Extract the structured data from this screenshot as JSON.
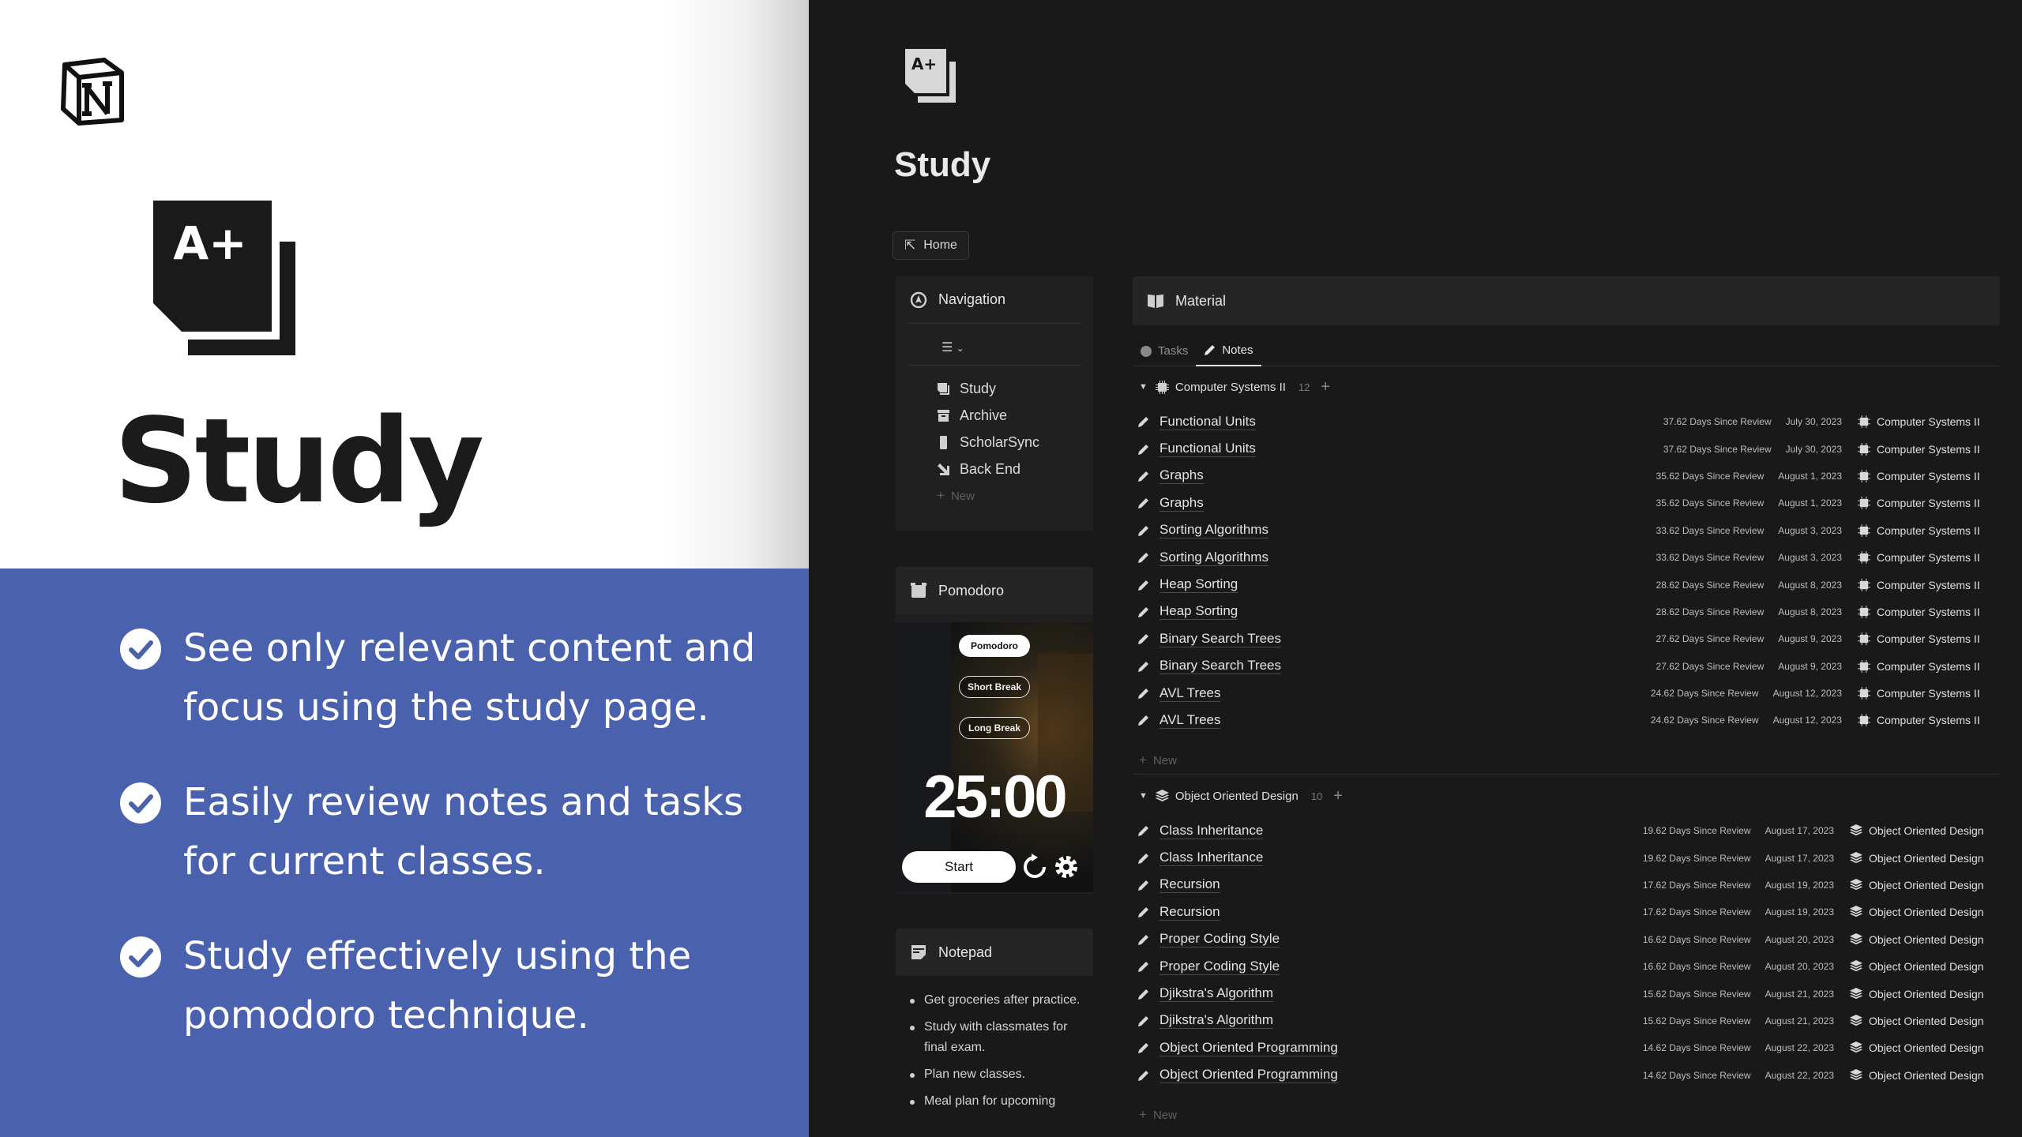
{
  "promo": {
    "title": "Study",
    "features": [
      {
        "line1": "See only relevant content and",
        "line2": "focus using the study page."
      },
      {
        "line1": "Easily review notes and tasks",
        "line2": "for current classes."
      },
      {
        "line1": "Study effectively using the",
        "line2": "pomodoro technique."
      }
    ],
    "colors": {
      "accent_blue": "#4a61ad",
      "app_bg": "#191919"
    }
  },
  "app": {
    "page_title": "Study",
    "icon_text": "A+",
    "home_label": "Home",
    "navigation": {
      "title": "Navigation",
      "items": [
        {
          "label": "Study",
          "icon": "study-icon"
        },
        {
          "label": "Archive",
          "icon": "archive-icon"
        },
        {
          "label": "ScholarSync",
          "icon": "phone-icon"
        },
        {
          "label": "Back End",
          "icon": "arrow-down-right-icon"
        }
      ],
      "new_label": "New"
    },
    "pomodoro": {
      "title": "Pomodoro",
      "modes": [
        "Pomodoro",
        "Short Break",
        "Long Break"
      ],
      "time": "25:00",
      "start_label": "Start"
    },
    "notepad": {
      "title": "Notepad",
      "items": [
        "Get groceries after practice.",
        "Study with classmates for final exam.",
        "Plan new classes.",
        "Meal plan for upcoming"
      ]
    },
    "material": {
      "title": "Material",
      "tabs": [
        "Tasks",
        "Notes"
      ],
      "active_tab": "Notes",
      "new_label": "New",
      "groups": [
        {
          "name": "Computer Systems II",
          "count": "12",
          "rows": [
            {
              "title": "Functional Units",
              "days": "37.62 Days Since Review",
              "date": "July 30, 2023",
              "course": "Computer Systems II"
            },
            {
              "title": "Functional Units",
              "days": "37.62 Days Since Review",
              "date": "July 30, 2023",
              "course": "Computer Systems II"
            },
            {
              "title": "Graphs",
              "days": "35.62 Days Since Review",
              "date": "August 1, 2023",
              "course": "Computer Systems II"
            },
            {
              "title": "Graphs",
              "days": "35.62 Days Since Review",
              "date": "August 1, 2023",
              "course": "Computer Systems II"
            },
            {
              "title": "Sorting Algorithms",
              "days": "33.62 Days Since Review",
              "date": "August 3, 2023",
              "course": "Computer Systems II"
            },
            {
              "title": "Sorting Algorithms",
              "days": "33.62 Days Since Review",
              "date": "August 3, 2023",
              "course": "Computer Systems II"
            },
            {
              "title": "Heap Sorting",
              "days": "28.62 Days Since Review",
              "date": "August 8, 2023",
              "course": "Computer Systems II"
            },
            {
              "title": "Heap Sorting",
              "days": "28.62 Days Since Review",
              "date": "August 8, 2023",
              "course": "Computer Systems II"
            },
            {
              "title": "Binary Search Trees",
              "days": "27.62 Days Since Review",
              "date": "August 9, 2023",
              "course": "Computer Systems II"
            },
            {
              "title": "Binary Search Trees",
              "days": "27.62 Days Since Review",
              "date": "August 9, 2023",
              "course": "Computer Systems II"
            },
            {
              "title": "AVL Trees",
              "days": "24.62 Days Since Review",
              "date": "August 12, 2023",
              "course": "Computer Systems II"
            },
            {
              "title": "AVL Trees",
              "days": "24.62 Days Since Review",
              "date": "August 12, 2023",
              "course": "Computer Systems II"
            }
          ]
        },
        {
          "name": "Object Oriented Design",
          "count": "10",
          "rows": [
            {
              "title": "Class Inheritance",
              "days": "19.62 Days Since Review",
              "date": "August 17, 2023",
              "course": "Object Oriented Design"
            },
            {
              "title": "Class Inheritance",
              "days": "19.62 Days Since Review",
              "date": "August 17, 2023",
              "course": "Object Oriented Design"
            },
            {
              "title": "Recursion",
              "days": "17.62 Days Since Review",
              "date": "August 19, 2023",
              "course": "Object Oriented Design"
            },
            {
              "title": "Recursion",
              "days": "17.62 Days Since Review",
              "date": "August 19, 2023",
              "course": "Object Oriented Design"
            },
            {
              "title": "Proper Coding Style",
              "days": "16.62 Days Since Review",
              "date": "August 20, 2023",
              "course": "Object Oriented Design"
            },
            {
              "title": "Proper Coding Style",
              "days": "16.62 Days Since Review",
              "date": "August 20, 2023",
              "course": "Object Oriented Design"
            },
            {
              "title": "Djikstra's Algorithm",
              "days": "15.62 Days Since Review",
              "date": "August 21, 2023",
              "course": "Object Oriented Design"
            },
            {
              "title": "Djikstra's Algorithm",
              "days": "15.62 Days Since Review",
              "date": "August 21, 2023",
              "course": "Object Oriented Design"
            },
            {
              "title": "Object Oriented Programming",
              "days": "14.62 Days Since Review",
              "date": "August 22, 2023",
              "course": "Object Oriented Design"
            },
            {
              "title": "Object Oriented Programming",
              "days": "14.62 Days Since Review",
              "date": "August 22, 2023",
              "course": "Object Oriented Design"
            }
          ]
        }
      ]
    }
  }
}
